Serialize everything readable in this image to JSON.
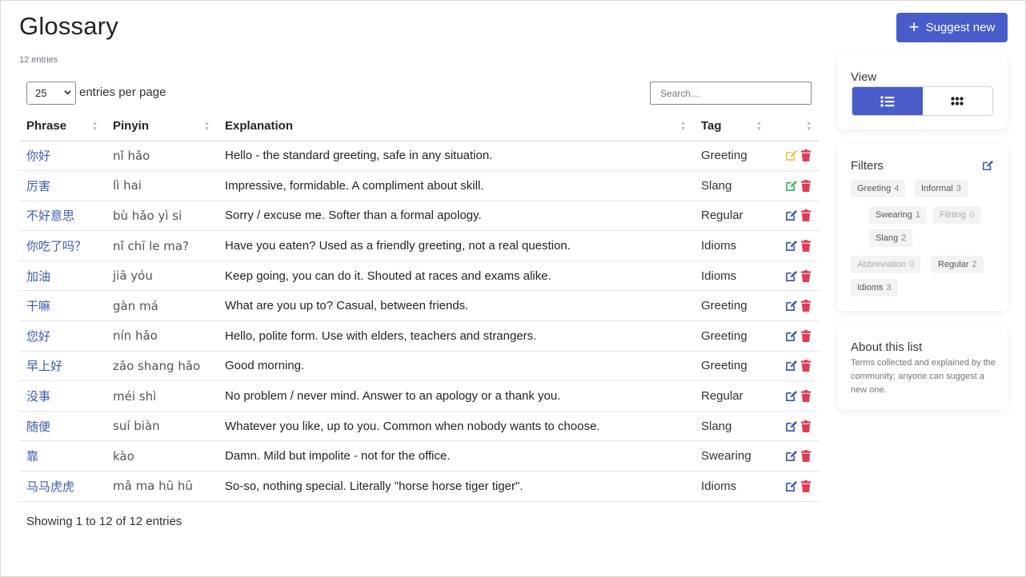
{
  "page": {
    "title": "Glossary",
    "entry_count": "12 entries",
    "suggest_label": "Suggest new"
  },
  "controls": {
    "per_page_value": "25",
    "per_page_label": "entries per page",
    "search_placeholder": "Search..."
  },
  "table": {
    "headers": [
      "Phrase",
      "Pinyin",
      "Explanation",
      "Tag"
    ],
    "rows": [
      {
        "phrase": "你好",
        "pinyin": "nǐ hǎo",
        "explanation": "Hello - the standard greeting, safe in any situation.",
        "tag": "Greeting",
        "edit_color": "#f3c14b"
      },
      {
        "phrase": "厉害",
        "pinyin": "lì hai",
        "explanation": "Impressive, formidable. A compliment about skill.",
        "tag": "Slang",
        "edit_color": "#3bb76a"
      },
      {
        "phrase": "不好意思",
        "pinyin": "bù hǎo yì si",
        "explanation": "Sorry / excuse me. Softer than a formal apology.",
        "tag": "Regular",
        "edit_color": "#3c5bb0"
      },
      {
        "phrase": "你吃了吗？",
        "pinyin": "nǐ chī le ma?",
        "explanation": "Have you eaten? Used as a friendly greeting, not a real question.",
        "tag": "Idioms",
        "edit_color": "#3c5bb0"
      },
      {
        "phrase": "加油",
        "pinyin": "jiā yóu",
        "explanation": "Keep going, you can do it. Shouted at races and exams alike.",
        "tag": "Idioms",
        "edit_color": "#3c5bb0"
      },
      {
        "phrase": "干嘛",
        "pinyin": "gàn má",
        "explanation": "What are you up to? Casual, between friends.",
        "tag": "Greeting",
        "edit_color": "#3c5bb0"
      },
      {
        "phrase": "您好",
        "pinyin": "nín hǎo",
        "explanation": "Hello, polite form. Use with elders, teachers and strangers.",
        "tag": "Greeting",
        "edit_color": "#3c5bb0"
      },
      {
        "phrase": "早上好",
        "pinyin": "zǎo shang hǎo",
        "explanation": "Good morning.",
        "tag": "Greeting",
        "edit_color": "#3c5bb0"
      },
      {
        "phrase": "没事",
        "pinyin": "méi shì",
        "explanation": "No problem / never mind. Answer to an apology or a thank you.",
        "tag": "Regular",
        "edit_color": "#3c5bb0"
      },
      {
        "phrase": "随便",
        "pinyin": "suí biàn",
        "explanation": "Whatever you like, up to you. Common when nobody wants to choose.",
        "tag": "Slang",
        "edit_color": "#3c5bb0"
      },
      {
        "phrase": "靠",
        "pinyin": "kào",
        "explanation": "Damn. Mild but impolite - not for the office.",
        "tag": "Swearing",
        "edit_color": "#3c5bb0"
      },
      {
        "phrase": "马马虎虎",
        "pinyin": "mǎ ma hū hū",
        "explanation": "So-so, nothing special. Literally \"horse horse tiger tiger\".",
        "tag": "Idioms",
        "edit_color": "#3c5bb0"
      }
    ],
    "showing": "Showing 1 to 12 of 12 entries"
  },
  "sidebar": {
    "view": {
      "title": "View",
      "active": "list"
    },
    "filters": {
      "title": "Filters",
      "chips": [
        {
          "label": "Greeting",
          "count": "4"
        },
        {
          "label": "Informal",
          "count": "3"
        },
        {
          "label": "Swearing",
          "count": "1"
        },
        {
          "label": "Flirting",
          "count": "0"
        },
        {
          "label": "Slang",
          "count": "2"
        },
        {
          "label": "Abbreviation",
          "count": "0"
        },
        {
          "label": "Regular",
          "count": "2"
        },
        {
          "label": "Idioms",
          "count": "3"
        }
      ]
    },
    "about": {
      "title": "About this list",
      "text": "Terms collected and explained by the community; anyone can suggest a new one."
    }
  },
  "colors": {
    "primary": "#4a5cc9",
    "link": "#3c5bb0",
    "delete": "#e03a57"
  }
}
